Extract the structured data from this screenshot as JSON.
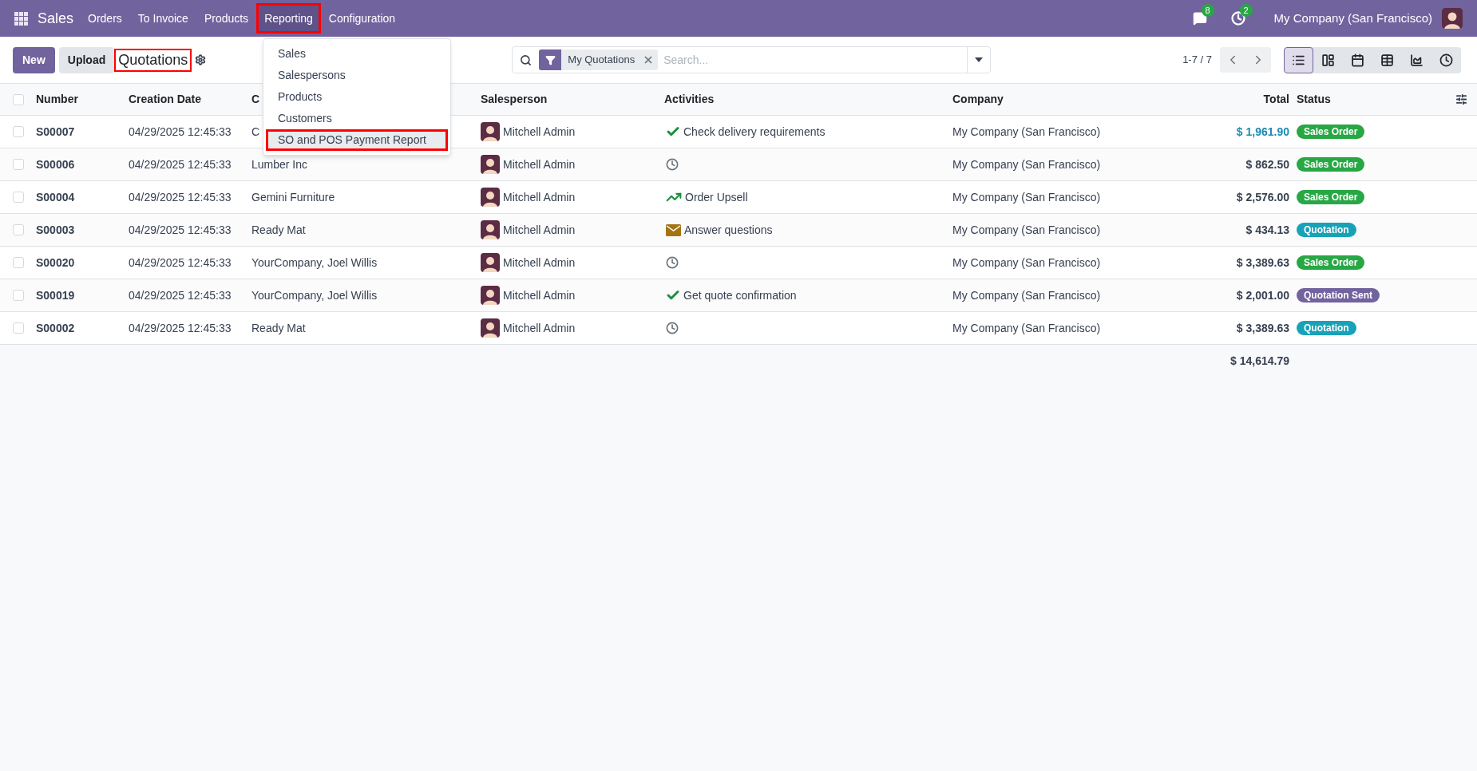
{
  "navbar": {
    "app": "Sales",
    "menu": [
      {
        "label": "Orders",
        "selected": false,
        "highlighted": false
      },
      {
        "label": "To Invoice",
        "selected": false,
        "highlighted": false
      },
      {
        "label": "Products",
        "selected": false,
        "highlighted": false
      },
      {
        "label": "Reporting",
        "selected": true,
        "highlighted": true
      },
      {
        "label": "Configuration",
        "selected": false,
        "highlighted": false
      }
    ],
    "messages_badge": "8",
    "activities_badge": "2",
    "company": "My Company (San Francisco)"
  },
  "control_panel": {
    "new_button": "New",
    "upload_button": "Upload",
    "title": "Quotations",
    "title_highlighted": true,
    "filter_facet": "My Quotations",
    "search_placeholder": "Search...",
    "pager": "1-7 / 7",
    "views": [
      {
        "kind": "list",
        "selected": true
      },
      {
        "kind": "kanban",
        "selected": false
      },
      {
        "kind": "calendar",
        "selected": false
      },
      {
        "kind": "pivot",
        "selected": false
      },
      {
        "kind": "graph",
        "selected": false
      },
      {
        "kind": "activity",
        "selected": false
      }
    ]
  },
  "reporting_menu": {
    "items": [
      {
        "label": "Sales",
        "highlighted": false
      },
      {
        "label": "Salespersons",
        "highlighted": false
      },
      {
        "label": "Products",
        "highlighted": false
      },
      {
        "label": "Customers",
        "highlighted": false
      },
      {
        "label": "SO and POS Payment Report",
        "highlighted": true
      }
    ]
  },
  "table": {
    "select_all_checked": false,
    "columns": [
      "Number",
      "Creation Date",
      "C",
      "Salesperson",
      "Activities",
      "Company",
      "Total",
      "Status"
    ],
    "rows": [
      {
        "checked": false,
        "number": "S00007",
        "created": "04/29/2025 12:45:33",
        "customer": "C",
        "salesperson": "Mitchell Admin",
        "activity": {
          "kind": "done",
          "label": "Check delivery requirements"
        },
        "company": "My Company (San Francisco)",
        "total": "$ 1,961.90",
        "total_accent": true,
        "status": {
          "label": "Sales Order",
          "color": "#28a745"
        }
      },
      {
        "checked": false,
        "number": "S00006",
        "created": "04/29/2025 12:45:33",
        "customer": "Lumber Inc",
        "salesperson": "Mitchell Admin",
        "activity": {
          "kind": "clock"
        },
        "company": "My Company (San Francisco)",
        "total": "$ 862.50",
        "total_accent": false,
        "status": {
          "label": "Sales Order",
          "color": "#28a745"
        }
      },
      {
        "checked": false,
        "number": "S00004",
        "created": "04/29/2025 12:45:33",
        "customer": "Gemini Furniture",
        "salesperson": "Mitchell Admin",
        "activity": {
          "kind": "upsell",
          "label": "Order Upsell"
        },
        "company": "My Company (San Francisco)",
        "total": "$ 2,576.00",
        "total_accent": false,
        "status": {
          "label": "Sales Order",
          "color": "#28a745"
        }
      },
      {
        "checked": false,
        "number": "S00003",
        "created": "04/29/2025 12:45:33",
        "customer": "Ready Mat",
        "salesperson": "Mitchell Admin",
        "activity": {
          "kind": "email",
          "label": "Answer questions"
        },
        "company": "My Company (San Francisco)",
        "total": "$ 434.13",
        "total_accent": false,
        "status": {
          "label": "Quotation",
          "color": "#17a2b8"
        }
      },
      {
        "checked": false,
        "number": "S00020",
        "created": "04/29/2025 12:45:33",
        "customer": "YourCompany, Joel Willis",
        "salesperson": "Mitchell Admin",
        "activity": {
          "kind": "clock"
        },
        "company": "My Company (San Francisco)",
        "total": "$ 3,389.63",
        "total_accent": false,
        "status": {
          "label": "Sales Order",
          "color": "#28a745"
        }
      },
      {
        "checked": false,
        "number": "S00019",
        "created": "04/29/2025 12:45:33",
        "customer": "YourCompany, Joel Willis",
        "salesperson": "Mitchell Admin",
        "activity": {
          "kind": "done",
          "label": "Get quote confirmation"
        },
        "company": "My Company (San Francisco)",
        "total": "$ 2,001.00",
        "total_accent": false,
        "status": {
          "label": "Quotation Sent",
          "color": "#71639e"
        }
      },
      {
        "checked": false,
        "number": "S00002",
        "created": "04/29/2025 12:45:33",
        "customer": "Ready Mat",
        "salesperson": "Mitchell Admin",
        "activity": {
          "kind": "clock"
        },
        "company": "My Company (San Francisco)",
        "total": "$ 3,389.63",
        "total_accent": false,
        "status": {
          "label": "Quotation",
          "color": "#17a2b8"
        }
      }
    ],
    "footer_total": "$ 14,614.79"
  }
}
